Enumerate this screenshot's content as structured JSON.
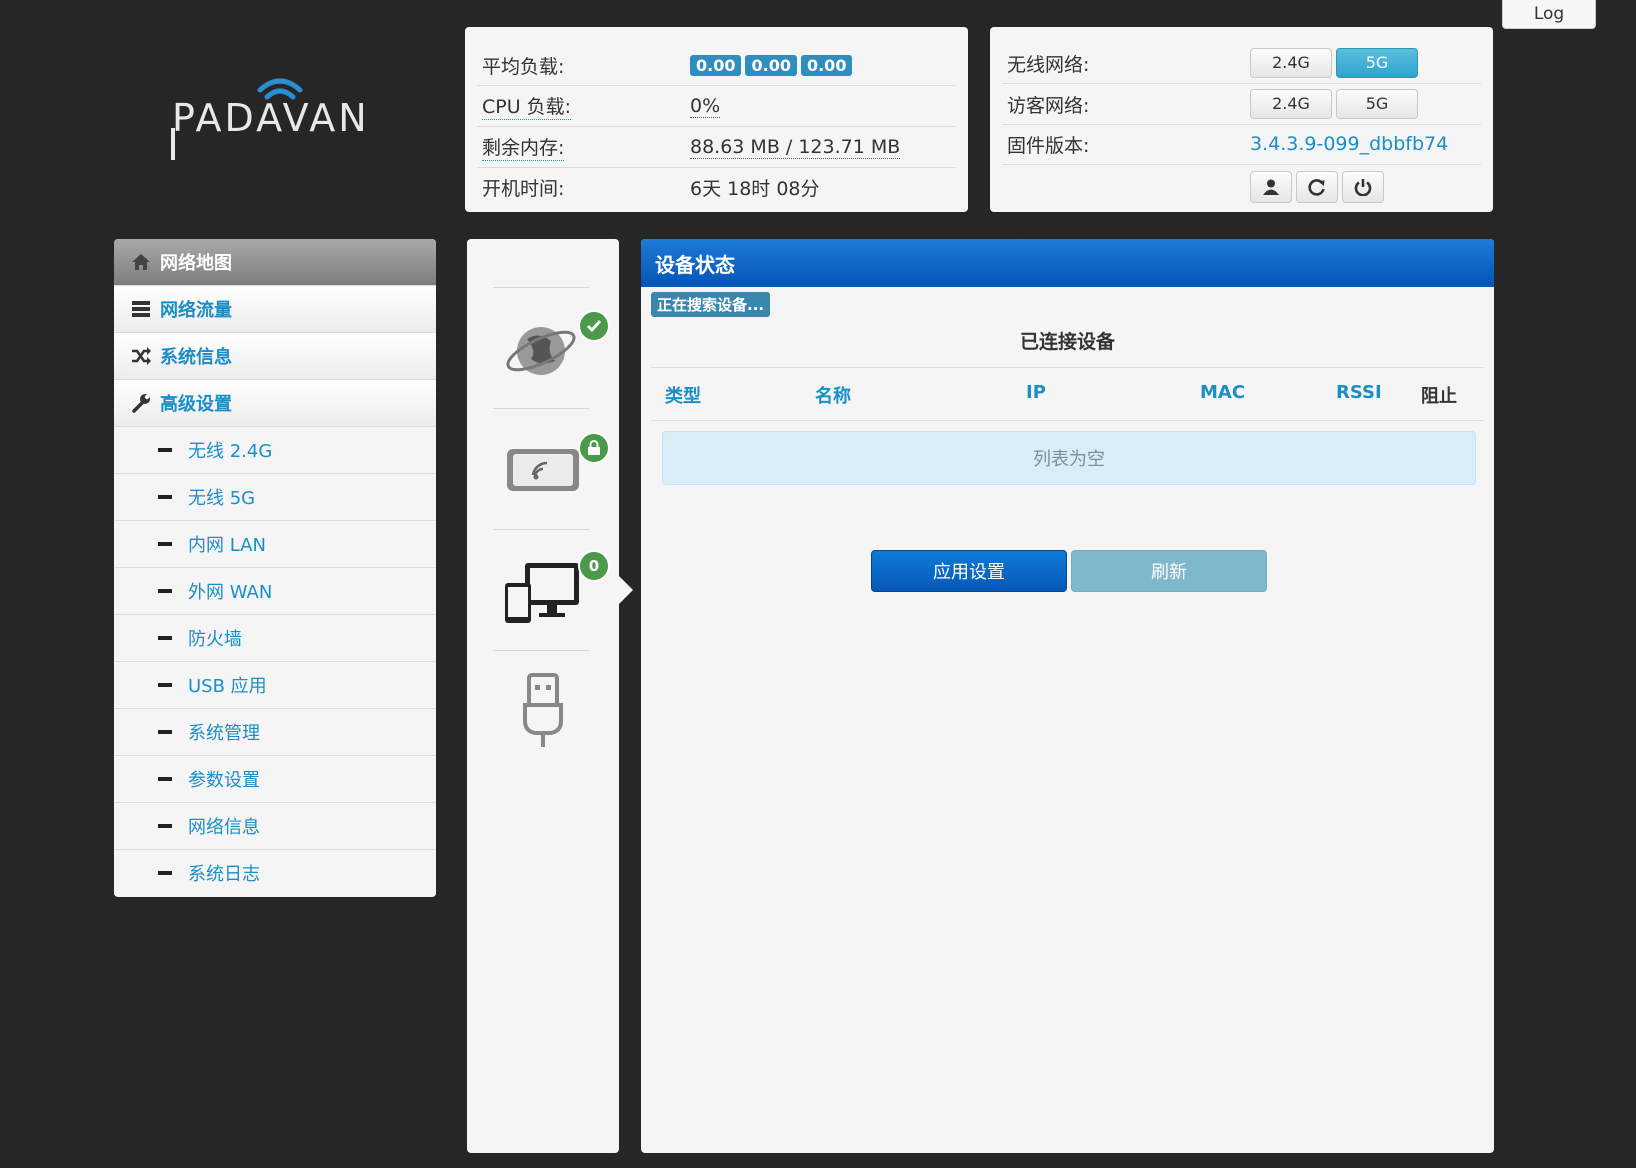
{
  "header": {
    "log_label": "Log",
    "logo_text": "PADAVAN"
  },
  "system": {
    "load_label": "平均负载:",
    "load_values": [
      "0.00",
      "0.00",
      "0.00"
    ],
    "cpu_label": "CPU 负载:",
    "cpu_value": "0%",
    "mem_label": "剩余内存:",
    "mem_value": "88.63 MB / 123.71 MB",
    "uptime_label": "开机时间:",
    "uptime_value": "6天 18时 08分"
  },
  "network": {
    "wireless_label": "无线网络:",
    "wireless_buttons": [
      "2.4G",
      "5G"
    ],
    "wireless_active": "5G",
    "guest_label": "访客网络:",
    "guest_buttons": [
      "2.4G",
      "5G"
    ],
    "firmware_label": "固件版本:",
    "firmware_value": "3.4.3.9-099_dbbfb74",
    "action_icons": [
      "user-icon",
      "refresh-icon",
      "power-icon"
    ]
  },
  "sidebar": {
    "items": [
      {
        "label": "网络地图",
        "icon": "home-icon",
        "active": true
      },
      {
        "label": "网络流量",
        "icon": "server-icon"
      },
      {
        "label": "系统信息",
        "icon": "shuffle-icon"
      },
      {
        "label": "高级设置",
        "icon": "wrench-icon"
      }
    ],
    "sub_items": [
      {
        "label": "无线 2.4G"
      },
      {
        "label": "无线 5G"
      },
      {
        "label": "内网 LAN"
      },
      {
        "label": "外网 WAN"
      },
      {
        "label": "防火墙"
      },
      {
        "label": "USB 应用"
      },
      {
        "label": "系统管理"
      },
      {
        "label": "参数设置"
      },
      {
        "label": "网络信息"
      },
      {
        "label": "系统日志"
      }
    ]
  },
  "status_icons": {
    "internet": {
      "icon": "globe-icon",
      "badge": "check"
    },
    "wireless": {
      "icon": "wireless-router-icon",
      "badge": "lock"
    },
    "clients": {
      "icon": "devices-icon",
      "badge": "0"
    },
    "usb": {
      "icon": "usb-icon"
    }
  },
  "main": {
    "title": "设备状态",
    "searching": "正在搜索设备...",
    "connected_title": "已连接设备",
    "columns": [
      "类型",
      "名称",
      "IP",
      "MAC",
      "RSSI",
      "阻止"
    ],
    "empty_message": "列表为空",
    "apply_label": "应用设置",
    "refresh_label": "刷新"
  },
  "colors": {
    "background": "#262626",
    "link": "#1a8fc7",
    "header_blue": "#0a64c6",
    "badge_green": "#4a9a4a"
  }
}
